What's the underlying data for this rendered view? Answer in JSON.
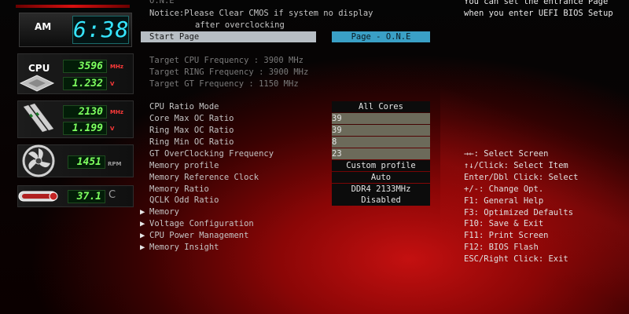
{
  "header": {
    "line1": "O.N.E",
    "notice_line1": "Notice:Please Clear CMOS if system no display",
    "notice_line2": "after overclocking"
  },
  "top_right_help": {
    "line1": "You can set the entrance Page",
    "line2": "when you enter UEFI BIOS Setup"
  },
  "left_panel": {
    "ampm": "AM",
    "clock": "6:38",
    "cpu_label": "CPU",
    "cpu_freq": "3596",
    "cpu_freq_unit": "MHz",
    "cpu_voltage": "1.232",
    "cpu_voltage_unit": "V",
    "mem_freq": "2130",
    "mem_freq_unit": "MHz",
    "mem_voltage": "1.199",
    "mem_voltage_unit": "V",
    "fan_speed": "1451",
    "fan_unit": "RPM",
    "temperature": "37.1",
    "temp_unit": "C",
    "accent_color": "#d81010",
    "lcd_color": "#7dff5f",
    "clock_color": "#36e6ff"
  },
  "start_page": {
    "label": "Start Page",
    "value": "Page - O.N.E"
  },
  "targets": [
    "Target CPU Frequency : 3900 MHz",
    "Target RING Frequency : 3900 MHz",
    "Target GT Frequency : 1150 MHz"
  ],
  "settings": [
    {
      "label": "CPU Ratio Mode",
      "value": "All Cores",
      "kind": "select"
    },
    {
      "label": "Core Max OC Ratio",
      "value": "39",
      "kind": "input"
    },
    {
      "label": "Ring Max OC Ratio",
      "value": "39",
      "kind": "input"
    },
    {
      "label": "Ring Min OC Ratio",
      "value": "8",
      "kind": "input"
    },
    {
      "label": "GT OverClocking Frequency",
      "value": "23",
      "kind": "input"
    },
    {
      "label": "Memory profile",
      "value": "Custom profile",
      "kind": "select"
    },
    {
      "label": "Memory Reference Clock",
      "value": "Auto",
      "kind": "select"
    },
    {
      "label": "Memory Ratio",
      "value": "DDR4 2133MHz",
      "kind": "select"
    },
    {
      "label": "QCLK Odd Ratio",
      "value": "Disabled",
      "kind": "select"
    }
  ],
  "submenus": [
    "Memory",
    "Voltage Configuration",
    "CPU Power Management",
    "Memory Insight"
  ],
  "help_keys": [
    "→←: Select Screen",
    "↑↓/Click: Select Item",
    "Enter/Dbl Click: Select",
    "+/-: Change Opt.",
    "F1: General Help",
    "F3: Optimized Defaults",
    "F10: Save & Exit",
    "F11: Print Screen",
    "F12: BIOS Flash",
    "ESC/Right Click: Exit"
  ],
  "icons": {
    "cpu": "cpu-chip-icon",
    "memory": "memory-module-icon",
    "fan": "fan-icon",
    "temperature": "thermometer-icon",
    "submenu": "triangle-right-icon"
  }
}
